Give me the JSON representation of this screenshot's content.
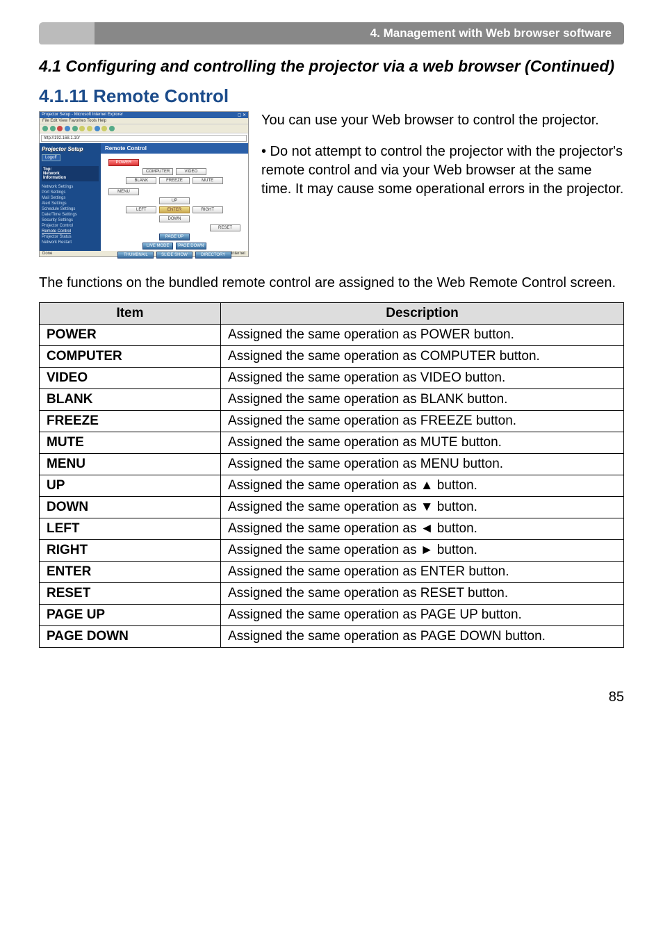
{
  "header": "4. Management with Web browser software",
  "section_title": "4.1 Configuring and controlling the projector via a web browser (Continued)",
  "subsection_title": "4.1.11 Remote Control",
  "intro_paragraph_1": "You can use your Web browser to control the projector.",
  "intro_paragraph_2": "• Do not attempt to control the projector with the projector's remote control and via your Web browser at the same time. It may cause some operational errors in the projector.",
  "body_text": "The functions on the bundled remote control are assigned to the Web Remote Control screen.",
  "table_headers": {
    "item": "Item",
    "description": "Description"
  },
  "rows": [
    {
      "item": "POWER",
      "desc": "Assigned the same operation as POWER button."
    },
    {
      "item": "COMPUTER",
      "desc": "Assigned the same operation as COMPUTER button."
    },
    {
      "item": "VIDEO",
      "desc": "Assigned the same operation as VIDEO button."
    },
    {
      "item": "BLANK",
      "desc": "Assigned the same operation as BLANK button."
    },
    {
      "item": "FREEZE",
      "desc": "Assigned the same operation as FREEZE button."
    },
    {
      "item": "MUTE",
      "desc": "Assigned the same operation as MUTE button."
    },
    {
      "item": "MENU",
      "desc": "Assigned the same operation as MENU button."
    },
    {
      "item": "UP",
      "desc": "Assigned the same operation as ▲ button."
    },
    {
      "item": "DOWN",
      "desc": "Assigned the same operation as ▼ button."
    },
    {
      "item": "LEFT",
      "desc": "Assigned the same operation as ◄ button."
    },
    {
      "item": "RIGHT",
      "desc": "Assigned the same operation as ► button."
    },
    {
      "item": "ENTER",
      "desc": "Assigned the same operation as ENTER button."
    },
    {
      "item": "RESET",
      "desc": "Assigned the same operation as RESET button."
    },
    {
      "item": "PAGE UP",
      "desc": "Assigned the same operation as PAGE UP button."
    },
    {
      "item": "PAGE DOWN",
      "desc": "Assigned the same operation as PAGE DOWN button."
    }
  ],
  "page_number": "85",
  "screenshot": {
    "window_title": "Projector Setup - Microsoft Internet Explorer",
    "menubar": "File  Edit  View  Favorites  Tools  Help",
    "address": "http://192.168.1.10/",
    "side_heading": "Projector Setup",
    "logoff": "Logoff",
    "side_group": "Top:\nNetwork\nInformation",
    "side_items": [
      "Network Settings",
      "Port Settings",
      "Mail Settings",
      "Alert Settings",
      "Schedule Settings",
      "Date/Time Settings",
      "Security Settings",
      "Projector Control",
      "Remote Control",
      "Projector Status",
      "Network Restart"
    ],
    "main_heading": "Remote Control",
    "buttons": {
      "power": "POWER",
      "computer": "COMPUTER",
      "video": "VIDEO",
      "blank": "BLANK",
      "freeze": "FREEZE",
      "mute": "MUTE",
      "menu": "MENU",
      "up": "UP",
      "left": "LEFT",
      "enter": "ENTER",
      "right": "RIGHT",
      "down": "DOWN",
      "reset": "RESET",
      "pageup": "PAGE UP",
      "pagedown": "PAGE DOWN",
      "livemode": "LIVE MODE",
      "thumbnail": "THUMBNAIL",
      "slideshow": "SLIDE SHOW",
      "directory": "DIRECTORY"
    },
    "status_left": "Done",
    "status_right": "Internet"
  }
}
